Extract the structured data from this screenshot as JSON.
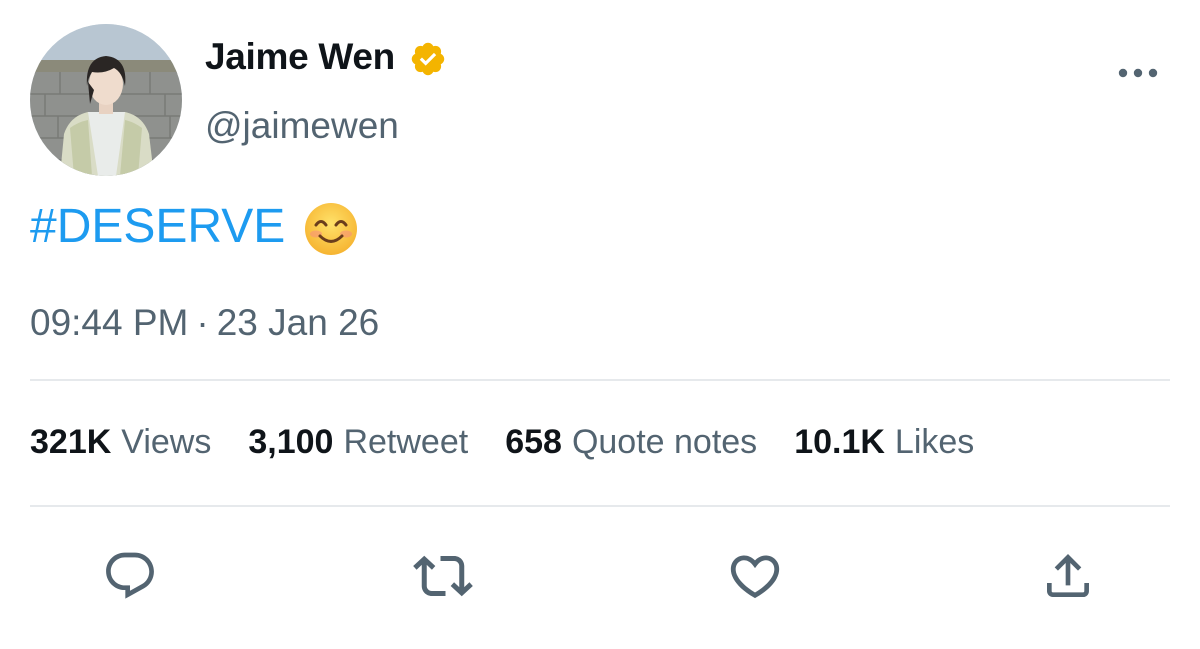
{
  "user": {
    "display_name": "Jaime Wen",
    "handle": "@jaimewen",
    "verified": true
  },
  "tweet": {
    "hashtag": "#DESERVE",
    "emoji": "smiling-face-with-smiling-eyes",
    "time": "09:44 PM",
    "separator": "·",
    "date": "23 Jan 26"
  },
  "stats": [
    {
      "value": "321K",
      "label": "Views"
    },
    {
      "value": "3,100",
      "label": "Retweet"
    },
    {
      "value": "658",
      "label": "Quote notes"
    },
    {
      "value": "10.1K",
      "label": "Likes"
    }
  ],
  "actions": [
    "reply-icon",
    "retweet-icon",
    "like-icon",
    "share-icon"
  ],
  "colors": {
    "link": "#1d9bf0",
    "secondary_text": "#536471",
    "primary_text": "#0f1419",
    "verified_badge": "#f4b400",
    "divider": "#e6e9ec"
  }
}
